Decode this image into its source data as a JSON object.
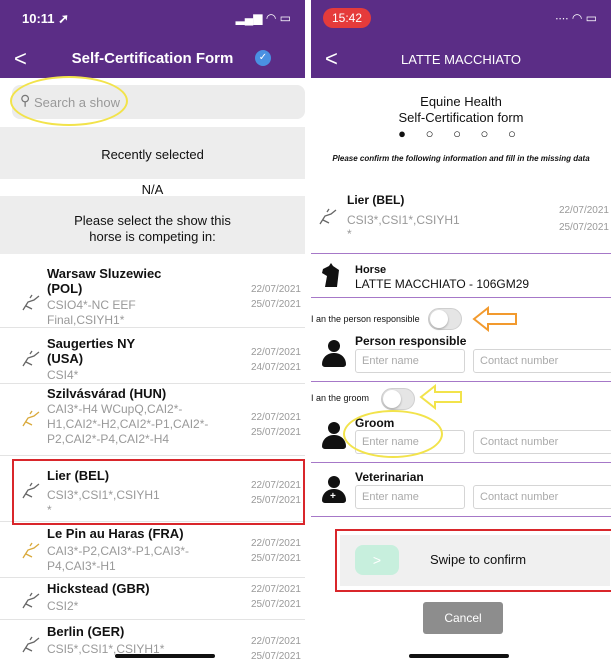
{
  "left": {
    "status_time": "10:11 ➚",
    "status_icons": "▂▄▆ ◠ ▭",
    "back": "<",
    "title": "Self-Certification Form",
    "search_placeholder": "Search a show",
    "recently_selected": "Recently selected",
    "na": "N/A",
    "prompt": "Please select the show this horse is competing in:",
    "shows": [
      {
        "name": "Warsaw Sluzewiec",
        "name2": "(POL)",
        "sub": "CSIO4*-NC EEF Final,CSIYH1*",
        "d1": "22/07/2021",
        "d2": "25/07/2021"
      },
      {
        "name": "Saugerties NY",
        "name2": "(USA)",
        "sub": "CSI4*",
        "d1": "22/07/2021",
        "d2": "24/07/2021"
      },
      {
        "name": "Szilvásvárad  (HUN)",
        "name2": "",
        "sub": "CAI3*-H4 WCupQ,CAI2*-H1,CAI2*-H2,CAI2*-P1,CAI2*-P2,CAI2*-P4,CAI2*-H4",
        "d1": "22/07/2021",
        "d2": "25/07/2021"
      },
      {
        "name": "Lier  (BEL)",
        "name2": "",
        "sub": "CSI3*,CSI1*,CSIYH1 *",
        "d1": "22/07/2021",
        "d2": "25/07/2021"
      },
      {
        "name": "Le Pin au Haras  (FRA)",
        "name2": "",
        "sub": "CAI3*-P2,CAI3*-P1,CAI3*-P4,CAI3*-H1",
        "d1": "22/07/2021",
        "d2": "25/07/2021"
      },
      {
        "name": "Hickstead  (GBR)",
        "name2": "",
        "sub": "CSI2*",
        "d1": "22/07/2021",
        "d2": "25/07/2021"
      },
      {
        "name": "Berlin  (GER)",
        "name2": "",
        "sub": "CSI5*,CSI1*,CSIYH1*",
        "d1": "22/07/2021",
        "d2": "25/07/2021"
      }
    ]
  },
  "right": {
    "status_time": "15:42",
    "status_icons": "∙∙∙∙ ◠ ▭",
    "back": "<",
    "title": "LATTE MACCHIATO",
    "heading1": "Equine Health",
    "heading2": "Self-Certification form",
    "steps": "● ○ ○ ○ ○",
    "note": "Please confirm the following information and fill in the missing data",
    "show_name": "Lier  (BEL)",
    "show_sub": "CSI3*,CSI1*,CSIYH1 *",
    "show_d1": "22/07/2021",
    "show_d2": "25/07/2021",
    "horse_label": "Horse",
    "horse_value": "LATTE MACCHIATO - 106GM29",
    "person_resp_toggle": "I an the person responsible",
    "person_resp_label": "Person responsible",
    "groom_toggle": "I an the groom",
    "groom_label": "Groom",
    "vet_label": "Veterinarian",
    "enter_name": "Enter name",
    "contact_number": "Contact number",
    "swipe_label": "Swipe to confirm",
    "swipe_arrow": ">",
    "cancel": "Cancel"
  }
}
